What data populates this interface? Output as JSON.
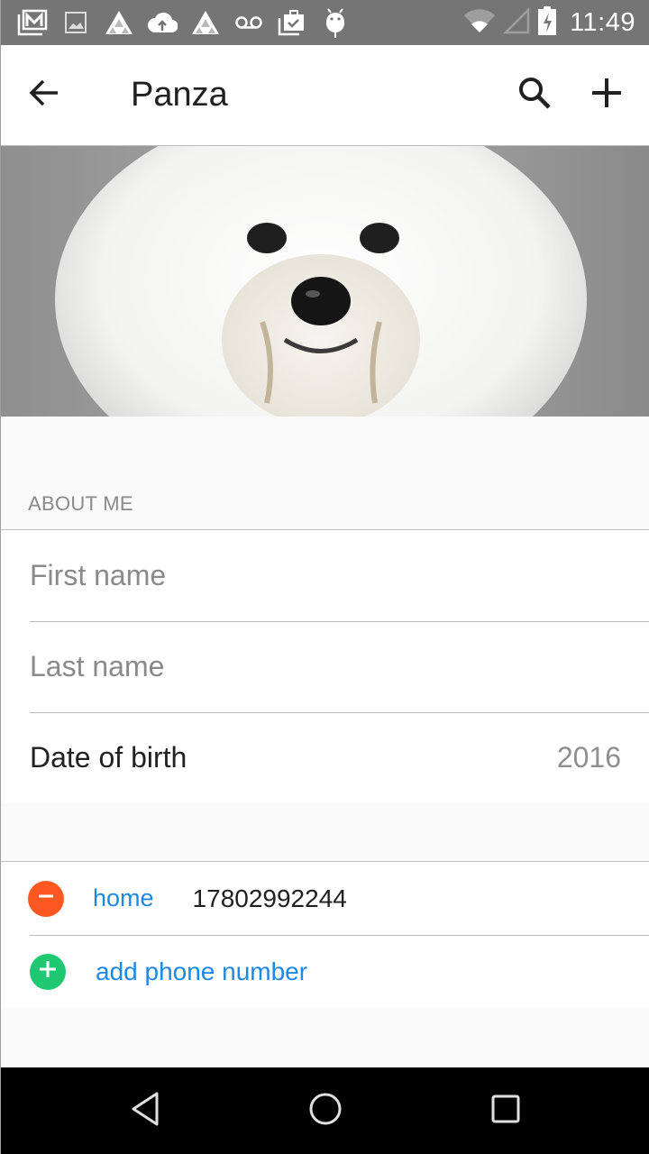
{
  "status_bar": {
    "notification_icons": [
      "gmail-icon",
      "gallery-icon",
      "app-triangle-icon",
      "cloud-upload-icon",
      "app-triangle-icon",
      "voicemail-icon",
      "clipboard-check-icon",
      "android-debug-icon"
    ],
    "system_icons": [
      "wifi-icon",
      "cell-signal-icon",
      "battery-charging-icon"
    ],
    "time": "11:49"
  },
  "app_bar": {
    "title": "Panza",
    "back_icon": "arrow-back-icon",
    "actions": [
      "search-icon",
      "add-icon"
    ]
  },
  "photo": {
    "description": "White fluffy Bichon Frise dog against a grey background"
  },
  "about_section": {
    "header": "ABOUT ME",
    "first_name": {
      "value": "",
      "placeholder": "First name"
    },
    "last_name": {
      "value": "",
      "placeholder": "Last name"
    },
    "date_of_birth": {
      "label": "Date of birth",
      "value": "2016"
    }
  },
  "phones": {
    "entries": [
      {
        "type": "home",
        "number": "17802992244"
      }
    ],
    "add_label": "add phone number"
  },
  "colors": {
    "status_bar": "#757575",
    "accent_blue": "#1e88e5",
    "remove_red": "#ff5722",
    "add_green": "#1ec971"
  },
  "nav_bar": {
    "buttons": [
      "back-triangle-icon",
      "home-circle-icon",
      "recents-square-icon"
    ]
  }
}
